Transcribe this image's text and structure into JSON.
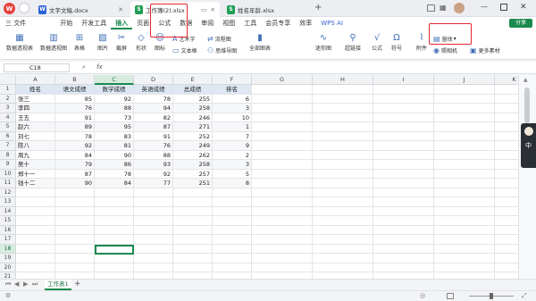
{
  "titlebar": {
    "tabs": [
      {
        "label": "文字文稿.docx",
        "icon_letter": "W",
        "icon_color": "#2b63d9"
      },
      {
        "label": "工作簿(2).xlsx",
        "icon_letter": "S",
        "icon_color": "#1f9d55"
      },
      {
        "label": "姓名年龄.xlsx",
        "icon_letter": "S",
        "icon_color": "#1f9d55"
      }
    ],
    "add_tab": "+",
    "app_logo": "W"
  },
  "menubar": {
    "file_label": "三 文件",
    "items": [
      "开始",
      "开发工具",
      "插入",
      "页面",
      "公式",
      "数据",
      "审阅",
      "视图",
      "工具",
      "会员专享",
      "效率",
      "WPS AI"
    ],
    "active_index": 2,
    "share_label": "分享"
  },
  "ribbon": {
    "items": [
      {
        "label": "数据透视表",
        "icon": "pivot-table-icon"
      },
      {
        "label": "数据透视图",
        "icon": "pivot-chart-icon"
      },
      {
        "label": "表格",
        "icon": "table-icon"
      },
      {
        "label": "图片",
        "icon": "picture-icon"
      },
      {
        "label": "截屏",
        "icon": "screenshot-icon"
      },
      {
        "label": "形状",
        "icon": "shape-icon"
      },
      {
        "label": "图标",
        "icon": "icon-icon"
      },
      {
        "label": "全部图表",
        "icon": "chart-icon"
      },
      {
        "label": "迷你图",
        "icon": "sparkline-icon"
      },
      {
        "label": "超链接",
        "icon": "hyperlink-icon"
      },
      {
        "label": "公式",
        "icon": "formula-icon"
      },
      {
        "label": "符号",
        "icon": "symbol-icon"
      },
      {
        "label": "附件",
        "icon": "attachment-icon"
      }
    ],
    "small_items": [
      {
        "label": "艺术字",
        "icon": "art-text-icon"
      },
      {
        "label": "流程图",
        "icon": "flowchart-icon"
      },
      {
        "label": "文本框",
        "icon": "textbox-icon"
      },
      {
        "label": "思维导图",
        "icon": "mindmap-icon"
      },
      {
        "label": "窗体",
        "icon": "form-icon"
      },
      {
        "label": "照相机",
        "icon": "camera-icon"
      },
      {
        "label": "更多素材",
        "icon": "more-material-icon"
      }
    ]
  },
  "formula": {
    "cell_ref": "C18",
    "fx": "fx",
    "value": ""
  },
  "sheet": {
    "columns": [
      "A",
      "B",
      "C",
      "D",
      "E",
      "F",
      "G",
      "H",
      "I",
      "J",
      "K"
    ],
    "row_numbers": [
      "1",
      "2",
      "3",
      "4",
      "5",
      "6",
      "7",
      "8",
      "9",
      "10",
      "11",
      "12",
      "13",
      "14",
      "15",
      "16",
      "17",
      "18",
      "19",
      "20",
      "21"
    ],
    "selected_col_index": 2,
    "selected_row_index": 17,
    "header": [
      "姓名",
      "语文成绩",
      "数学成绩",
      "英语成绩",
      "总成绩",
      "排名"
    ],
    "rows": [
      [
        "张三",
        "85",
        "92",
        "78",
        "255",
        "6"
      ],
      [
        "李四",
        "76",
        "88",
        "94",
        "258",
        "3"
      ],
      [
        "王五",
        "91",
        "73",
        "82",
        "246",
        "10"
      ],
      [
        "赵六",
        "89",
        "95",
        "87",
        "271",
        "1"
      ],
      [
        "刘七",
        "78",
        "83",
        "91",
        "252",
        "7"
      ],
      [
        "陈八",
        "92",
        "81",
        "76",
        "249",
        "9"
      ],
      [
        "周九",
        "84",
        "90",
        "88",
        "262",
        "2"
      ],
      [
        "吴十",
        "79",
        "86",
        "93",
        "258",
        "3"
      ],
      [
        "郑十一",
        "87",
        "78",
        "92",
        "257",
        "5"
      ],
      [
        "钱十二",
        "90",
        "84",
        "77",
        "251",
        "8"
      ]
    ]
  },
  "sheetbar": {
    "tabs": [
      "工作表1"
    ],
    "add": "+"
  },
  "accents": {
    "green": "#1b8a4e",
    "red_highlight": "#e3262f"
  }
}
